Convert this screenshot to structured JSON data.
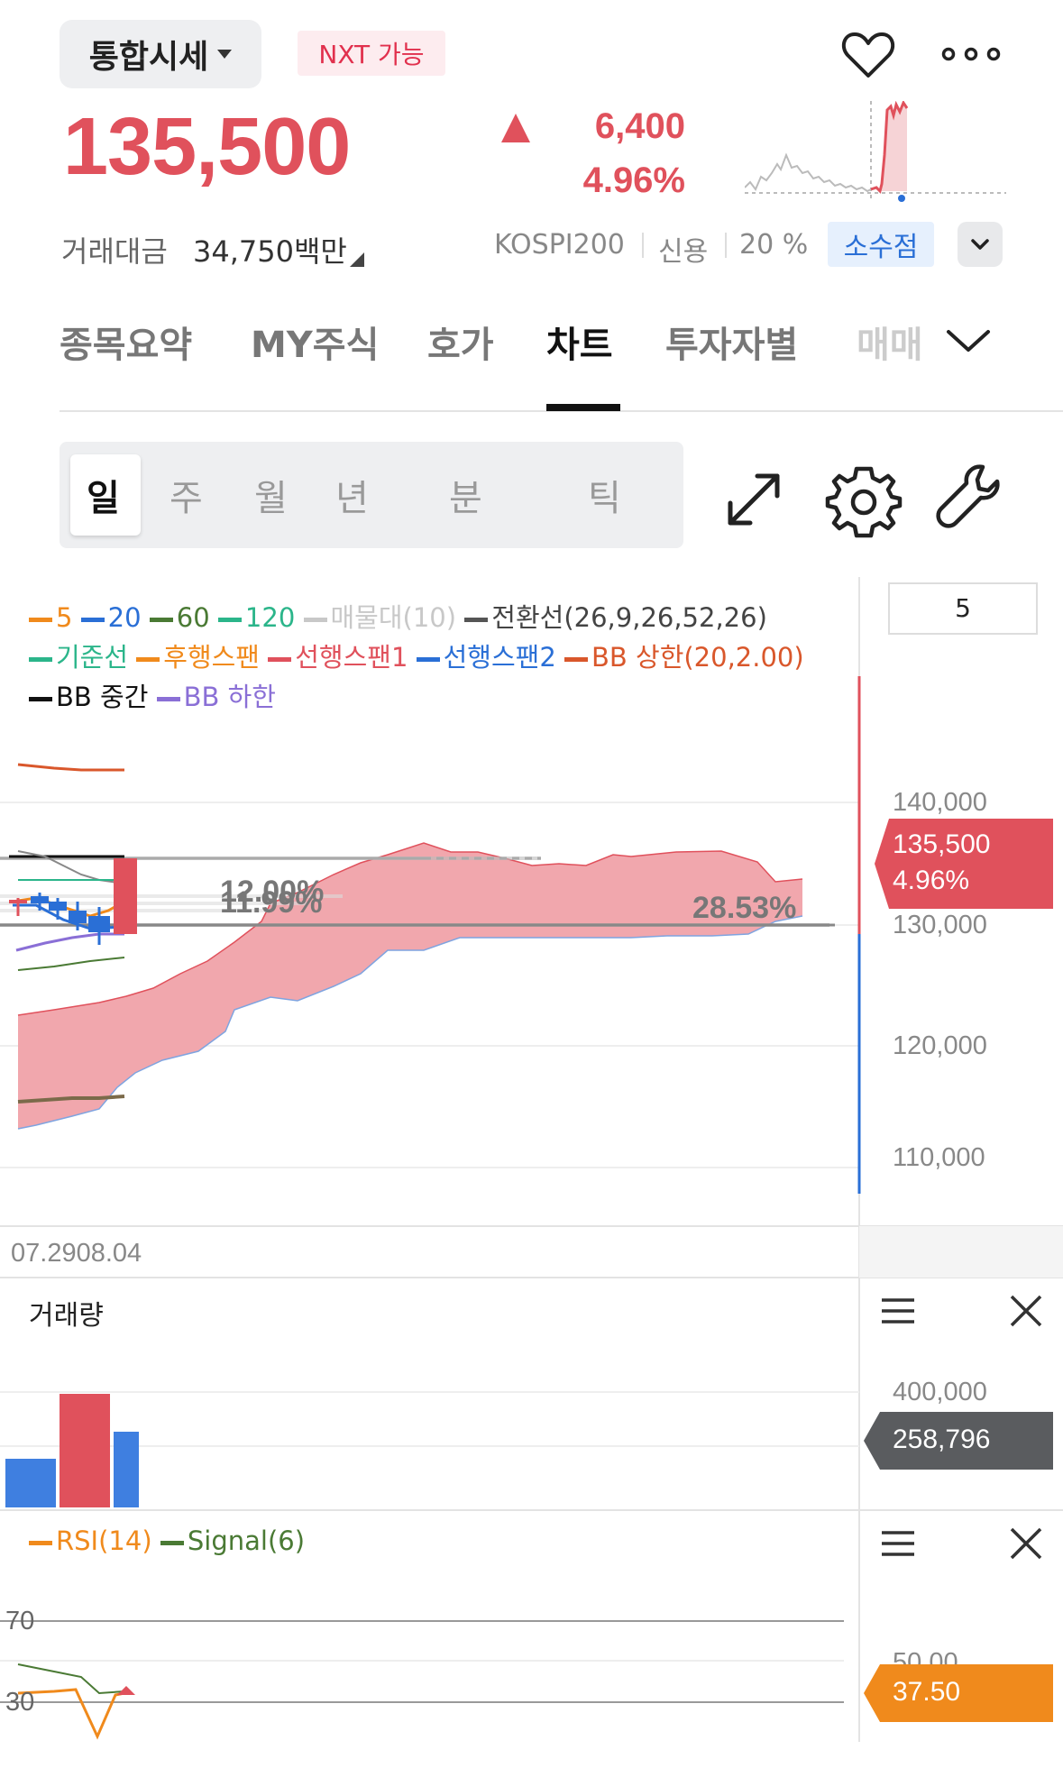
{
  "header": {
    "dropdown_label": "통합시세",
    "nxt_badge": "NXT 가능",
    "price": "135,500",
    "change_value": "6,400",
    "change_pct": "4.96%",
    "trade_label": "거래대금",
    "trade_value": "34,750백만",
    "index_tag": "KOSPI200",
    "credit_tag": "신용",
    "margin_tag": "20 %",
    "fraction_badge": "소수점"
  },
  "tabs": [
    "종목요약",
    "MY주식",
    "호가",
    "차트",
    "투자자별",
    "매매"
  ],
  "active_tab": "차트",
  "periods": [
    "일",
    "주",
    "월",
    "년",
    "분",
    "틱"
  ],
  "active_period": "일",
  "legend": {
    "row1": [
      {
        "label": "5",
        "color": "#f08a1c"
      },
      {
        "label": "20",
        "color": "#2a6fd6"
      },
      {
        "label": "60",
        "color": "#4a7a34"
      },
      {
        "label": "120",
        "color": "#2bb58a"
      },
      {
        "label": "매물대(10)",
        "color": "#c8c8c8"
      },
      {
        "label": "전환선(26,9,26,52,26)",
        "color": "#555555"
      }
    ],
    "row2": [
      {
        "label": "기준선",
        "color": "#2bb58a"
      },
      {
        "label": "후행스팬",
        "color": "#f08a1c"
      },
      {
        "label": "선행스팬1",
        "color": "#e0515c"
      },
      {
        "label": "선행스팬2",
        "color": "#2a6fd6"
      },
      {
        "label": "BB 상한(20,2.00)",
        "color": "#d9572b"
      }
    ],
    "row3": [
      {
        "label": "BB 중간",
        "color": "#111111"
      },
      {
        "label": "BB 하한",
        "color": "#8a6fd6"
      }
    ]
  },
  "price_box_value": "5",
  "y_axis": [
    "140,000",
    "130,000",
    "120,000",
    "110,000"
  ],
  "current_price_tag": {
    "price": "135,500",
    "pct": "4.96%"
  },
  "annotations": {
    "pct_a": "12.00%",
    "pct_b": "11.99%",
    "pct_c": "28.53%"
  },
  "x_axis": "07.2908.04",
  "volume_pane": {
    "title": "거래량",
    "y_axis": [
      "400,000"
    ],
    "current": "258,796"
  },
  "rsi_pane": {
    "legend": [
      {
        "label": "RSI(14)",
        "color": "#f08a1c"
      },
      {
        "label": "Signal(6)",
        "color": "#4a7a34"
      }
    ],
    "levels": [
      "70",
      "30"
    ],
    "y_axis": [
      "50.00"
    ],
    "current": "37.50"
  },
  "colors": {
    "up": "#e0515c",
    "down": "#2a6fd6",
    "badge_pink_bg": "#fdecef",
    "badge_blue_bg": "#e6f0fd"
  },
  "icons": [
    "heart-icon",
    "more-icon",
    "expand-icon",
    "gear-icon",
    "wrench-icon",
    "menu-icon",
    "close-icon",
    "chevron-down-icon"
  ]
}
